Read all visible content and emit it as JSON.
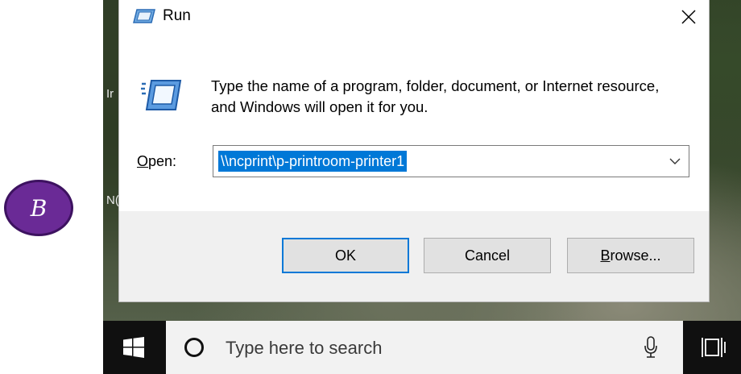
{
  "annotation": {
    "badge_letter": "B"
  },
  "desktop": {
    "fragments": [
      "Ir",
      "N("
    ]
  },
  "dialog": {
    "title": "Run",
    "description": "Type the name of a program, folder, document, or Internet resource, and Windows will open it for you.",
    "open_label_underlined": "O",
    "open_label_rest": "pen:",
    "open_value": "\\\\ncprint\\p-printroom-printer1",
    "buttons": {
      "ok": "OK",
      "cancel": "Cancel",
      "browse_underlined": "B",
      "browse_rest": "rowse..."
    },
    "icons": {
      "title": "run-icon",
      "close": "close-icon",
      "dropdown": "chevron-down-icon"
    }
  },
  "taskbar": {
    "search_placeholder": "Type here to search",
    "icons": [
      "windows-start-icon",
      "cortana-circle-icon",
      "microphone-icon",
      "task-view-icon"
    ]
  },
  "colors": {
    "selection": "#0078d7",
    "footer": "#f0f0f0",
    "taskbar": "#101010",
    "badge": "#6a2a96"
  }
}
